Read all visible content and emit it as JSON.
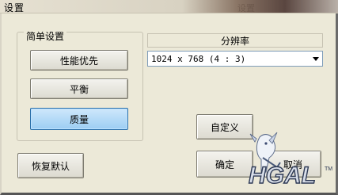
{
  "window": {
    "title": "设置",
    "title_bg_text": "设置"
  },
  "simple_group": {
    "label": "简单设置",
    "buttons": [
      {
        "label": "性能优先",
        "selected": false
      },
      {
        "label": "平衡",
        "selected": false
      },
      {
        "label": "质量",
        "selected": true
      }
    ]
  },
  "resolution": {
    "header": "分辨率",
    "selected": "1024 x 768 (4 : 3)"
  },
  "buttons": {
    "custom": "自定义",
    "restore_default": "恢复默认",
    "ok": "确定",
    "cancel": "取消"
  },
  "watermark": {
    "text": "HGAL",
    "tm": "TM"
  }
}
